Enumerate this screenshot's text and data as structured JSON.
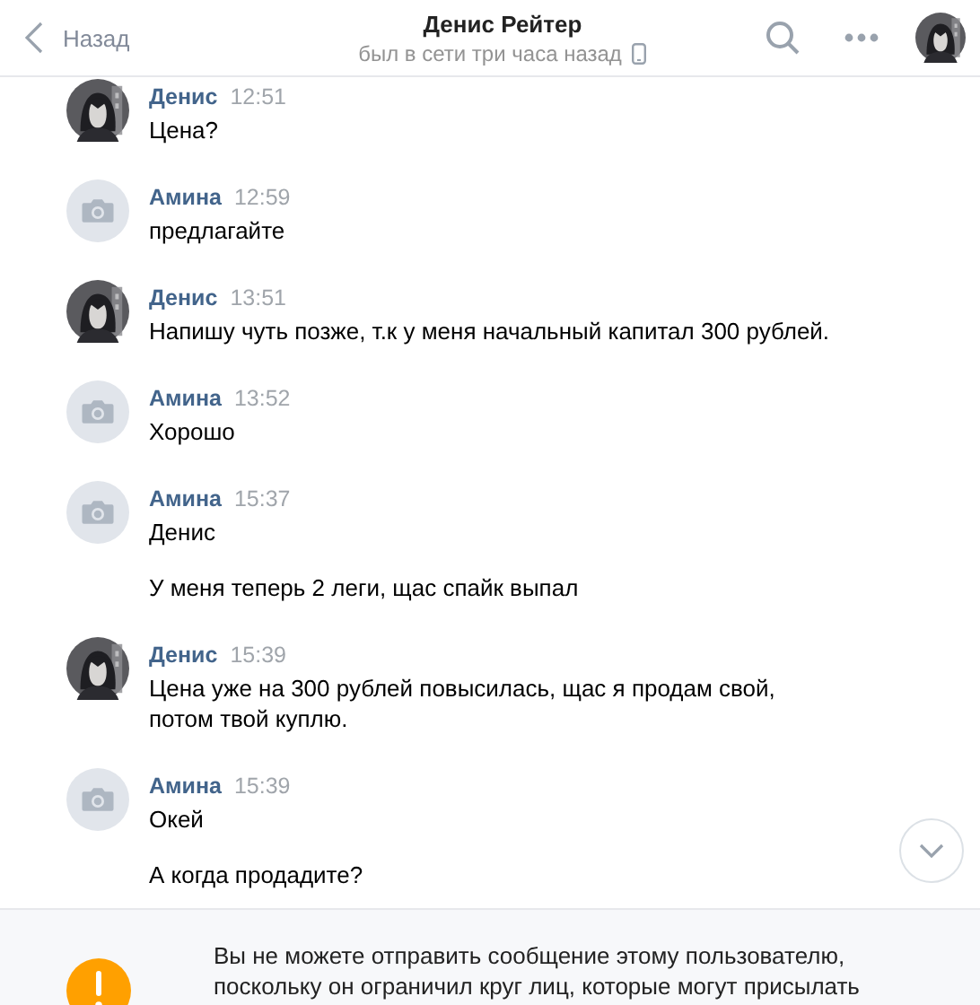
{
  "header": {
    "back": "Назад",
    "title": "Денис Рейтер",
    "status": "был в сети три часа назад"
  },
  "messages": [
    {
      "sender": "Денис",
      "kind": "picture",
      "time": "12:51",
      "texts": [
        "Цена?"
      ]
    },
    {
      "sender": "Амина",
      "kind": "camera",
      "time": "12:59",
      "texts": [
        "предлагайте"
      ]
    },
    {
      "sender": "Денис",
      "kind": "picture",
      "time": "13:51",
      "texts": [
        "Напишу чуть позже, т.к у меня начальный капитал 300 рублей."
      ]
    },
    {
      "sender": "Амина",
      "kind": "camera",
      "time": "13:52",
      "texts": [
        "Хорошо"
      ]
    },
    {
      "sender": "Амина",
      "kind": "camera",
      "time": "15:37",
      "texts": [
        "Денис",
        "У меня теперь 2 леги, щас спайк выпал"
      ]
    },
    {
      "sender": "Денис",
      "kind": "picture",
      "time": "15:39",
      "texts": [
        "Цена уже на 300 рублей повысилась, щас я продам свой,\nпотом твой куплю."
      ]
    },
    {
      "sender": "Амина",
      "kind": "camera",
      "time": "15:39",
      "texts": [
        "Окей",
        "А когда продадите?"
      ]
    }
  ],
  "notice": "Вы не можете отправить сообщение этому пользователю, поскольку он ограничил круг лиц, которые могут присылать"
}
